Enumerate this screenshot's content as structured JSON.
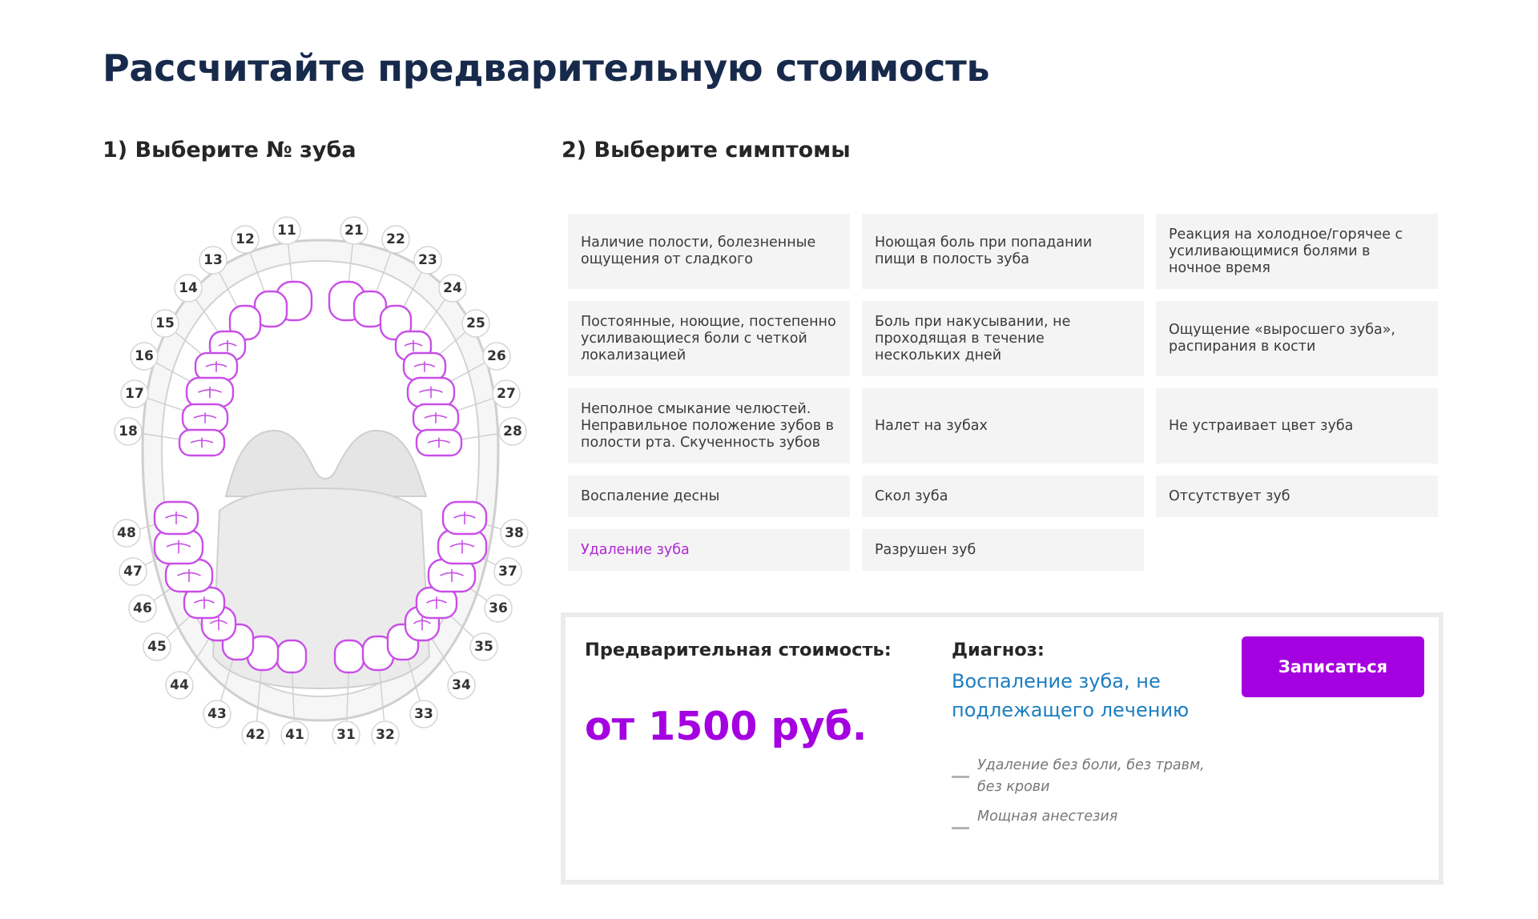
{
  "page": {
    "title": "Рассчитайте предварительную стоимость",
    "step1_title": "1) Выберите № зуба",
    "step2_title": "2) Выберите симптомы"
  },
  "tooth_chart": {
    "highlight_color": "#c84fe6",
    "upper_right": [
      "11",
      "12",
      "13",
      "14",
      "15",
      "16",
      "17",
      "18"
    ],
    "upper_left": [
      "21",
      "22",
      "23",
      "24",
      "25",
      "26",
      "27",
      "28"
    ],
    "lower_left": [
      "31",
      "32",
      "33",
      "34",
      "35",
      "36",
      "37",
      "38"
    ],
    "lower_right": [
      "41",
      "42",
      "43",
      "44",
      "45",
      "46",
      "47",
      "48"
    ]
  },
  "symptoms": [
    {
      "label": "Наличие полости, болезненные ощущения от сладкого",
      "selected": false
    },
    {
      "label": "Ноющая боль при попадании пищи в полость зуба",
      "selected": false
    },
    {
      "label": "Реакция на холодное/горячее с усиливающимися болями в ночное время",
      "selected": false
    },
    {
      "label": "Постоянные, ноющие, постепенно усиливающиеся боли с четкой локализацией",
      "selected": false
    },
    {
      "label": "Боль при накусывании, не проходящая в течение нескольких дней",
      "selected": false
    },
    {
      "label": "Ощущение «выросшего зуба», распирания в кости",
      "selected": false
    },
    {
      "label": "Неполное смыкание челюстей. Неправильное положение зубов в полости рта. Скученность зубов",
      "selected": false
    },
    {
      "label": "Налет на зубах",
      "selected": false
    },
    {
      "label": "Не устраивает цвет зуба",
      "selected": false
    },
    {
      "label": "Воспаление десны",
      "selected": false
    },
    {
      "label": "Скол зуба",
      "selected": false
    },
    {
      "label": "Отсутствует зуб",
      "selected": false
    },
    {
      "label": "Удаление зуба",
      "selected": true
    },
    {
      "label": "Разрушен зуб",
      "selected": false
    }
  ],
  "result": {
    "price_label": "Предварительная стоимость:",
    "price_value": "от 1500 руб.",
    "diagnosis_label": "Диагноз:",
    "diagnosis_value": "Воспаление зуба, не подлежащего лечению",
    "features": [
      "Удаление без боли, без травм, без крови",
      "Мощная анестезия"
    ],
    "button_label": "Записаться"
  },
  "colors": {
    "accent": "#a400e0",
    "title": "#172a4b",
    "diagnosis": "#1c7ec0",
    "tile_bg": "#f4f4f4"
  }
}
